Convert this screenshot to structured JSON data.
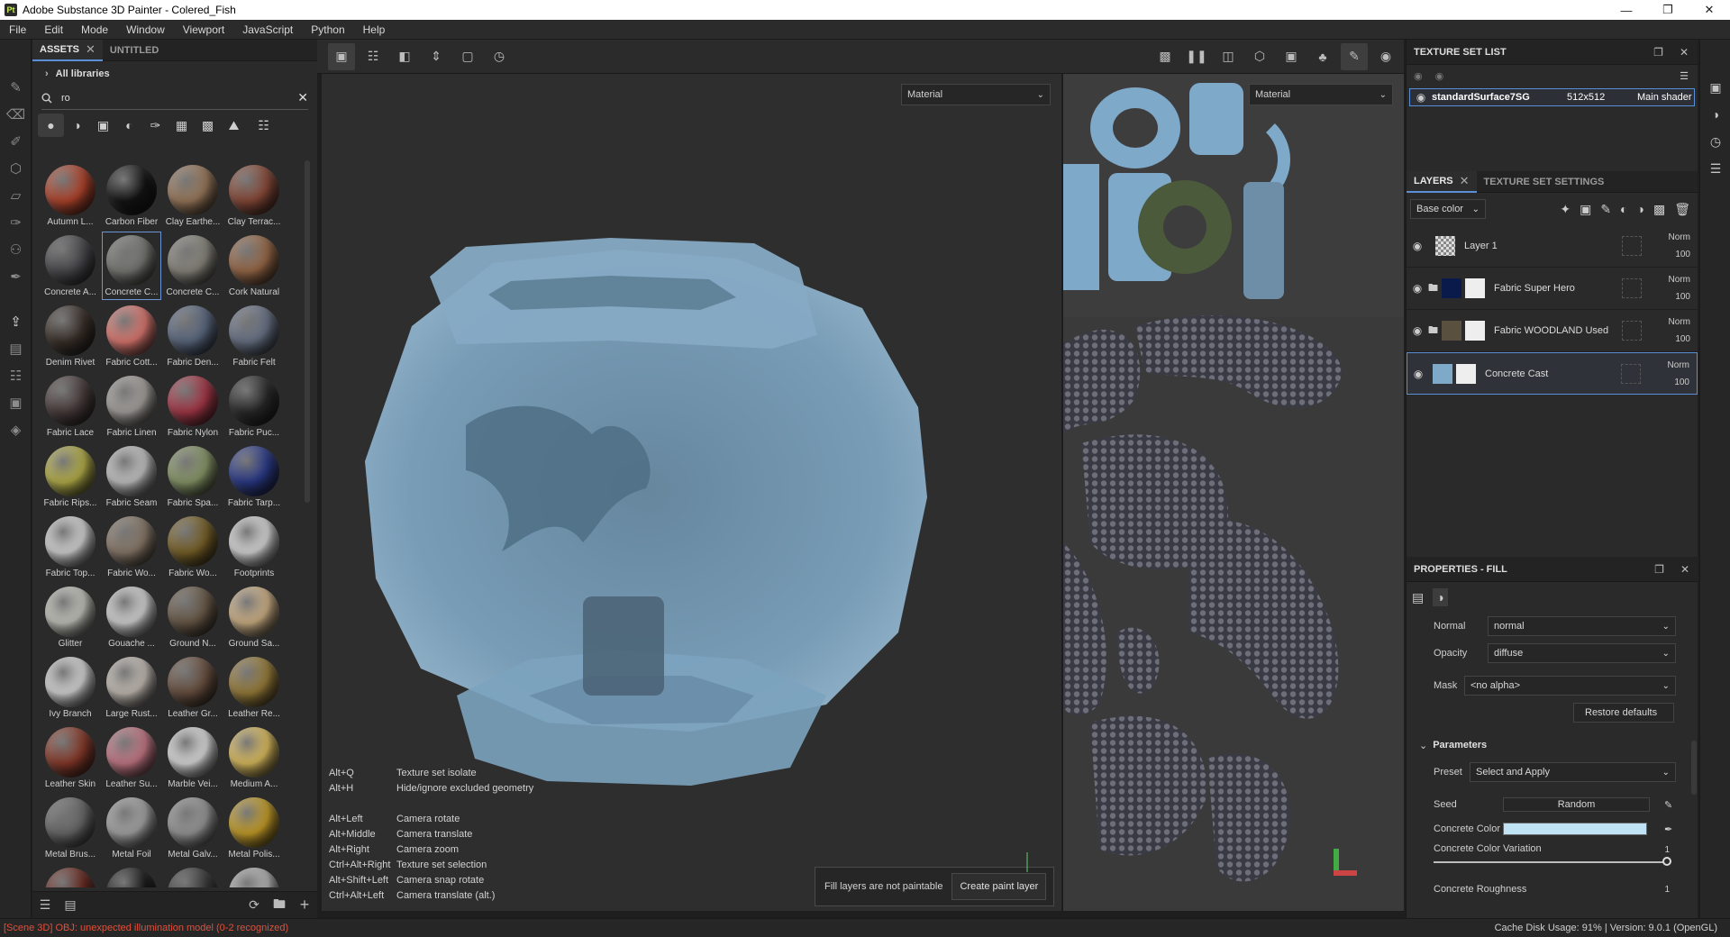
{
  "window": {
    "title": "Adobe Substance 3D Painter - Colered_Fish",
    "app_badge": "Pt"
  },
  "menu": [
    "File",
    "Edit",
    "Mode",
    "Window",
    "Viewport",
    "JavaScript",
    "Python",
    "Help"
  ],
  "assets": {
    "tabs": [
      {
        "label": "ASSETS"
      },
      {
        "label": "UNTITLED"
      }
    ],
    "library": "All libraries",
    "search_value": "ro",
    "items": [
      {
        "label": "Autumn L...",
        "color": "#b4452c"
      },
      {
        "label": "Carbon Fiber",
        "color": "#141414"
      },
      {
        "label": "Clay Earthe...",
        "color": "#9c7a5c"
      },
      {
        "label": "Clay Terrac...",
        "color": "#8a4a38"
      },
      {
        "label": "Concrete A...",
        "color": "#4a4a4e"
      },
      {
        "label": "Concrete C...",
        "color": "#7a7a76"
      },
      {
        "label": "Concrete C...",
        "color": "#8a887e"
      },
      {
        "label": "Cork Natural",
        "color": "#9a6a48"
      },
      {
        "label": "Denim Rivet",
        "color": "#3a302a"
      },
      {
        "label": "Fabric Cott...",
        "color": "#e07a72"
      },
      {
        "label": "Fabric Den...",
        "color": "#5c6a82"
      },
      {
        "label": "Fabric Felt",
        "color": "#6a7488"
      },
      {
        "label": "Fabric Lace",
        "color": "#4a3c3c"
      },
      {
        "label": "Fabric Linen",
        "color": "#a8a4a0"
      },
      {
        "label": "Fabric Nylon",
        "color": "#a83848"
      },
      {
        "label": "Fabric Puc...",
        "color": "#2a2a2a"
      },
      {
        "label": "Fabric Rips...",
        "color": "#b8b24a"
      },
      {
        "label": "Fabric Seam",
        "color": "#c8c8c8"
      },
      {
        "label": "Fabric Spa...",
        "color": "#8a9a6a"
      },
      {
        "label": "Fabric Tarp...",
        "color": "#2a3a8a"
      },
      {
        "label": "Fabric Top...",
        "color": "#d8d8d8"
      },
      {
        "label": "Fabric Wo...",
        "color": "#8a7a6a"
      },
      {
        "label": "Fabric Wo...",
        "color": "#7a6228"
      },
      {
        "label": "Footprints",
        "color": "#dcdcdc"
      },
      {
        "label": "Glitter",
        "color": "#c8c8c0"
      },
      {
        "label": "Gouache ...",
        "color": "#d8d8d8"
      },
      {
        "label": "Ground N...",
        "color": "#6a5a48"
      },
      {
        "label": "Ground Sa...",
        "color": "#d2b488"
      },
      {
        "label": "Ivy Branch",
        "color": "#dadada"
      },
      {
        "label": "Large Rust...",
        "color": "#c8c0b8"
      },
      {
        "label": "Leather Gr...",
        "color": "#6a5040"
      },
      {
        "label": "Leather Re...",
        "color": "#9a7e3a"
      },
      {
        "label": "Leather Skin",
        "color": "#8a3a2a"
      },
      {
        "label": "Leather Su...",
        "color": "#c87a88"
      },
      {
        "label": "Marble Vei...",
        "color": "#e0e0e0"
      },
      {
        "label": "Medium A...",
        "color": "#e0c060"
      },
      {
        "label": "Metal Brus...",
        "color": "#6a6a6a"
      },
      {
        "label": "Metal Foil",
        "color": "#a8a8a8"
      },
      {
        "label": "Metal Galv...",
        "color": "#9a9a9a"
      },
      {
        "label": "Metal Polis...",
        "color": "#c8a028"
      },
      {
        "label": "",
        "color": "#6a2a20"
      },
      {
        "label": "",
        "color": "#1a1a1a"
      },
      {
        "label": "",
        "color": "#3a3a3a"
      },
      {
        "label": "",
        "color": "#b8b8b8"
      }
    ]
  },
  "viewport3d": {
    "mode_dropdown": "Material",
    "shortcuts": [
      {
        "key": "Alt+Q",
        "action": "Texture set isolate"
      },
      {
        "key": "Alt+H",
        "action": "Hide/ignore excluded geometry"
      },
      {
        "key": "",
        "action": ""
      },
      {
        "key": "Alt+Left",
        "action": "Camera rotate"
      },
      {
        "key": "Alt+Middle",
        "action": "Camera translate"
      },
      {
        "key": "Alt+Right",
        "action": "Camera zoom"
      },
      {
        "key": "Ctrl+Alt+Right",
        "action": "Texture set selection"
      },
      {
        "key": "Alt+Shift+Left",
        "action": "Camera snap rotate"
      },
      {
        "key": "Ctrl+Alt+Left",
        "action": "Camera translate (alt.)"
      }
    ],
    "notice_text": "Fill layers are not paintable",
    "notice_button": "Create paint layer"
  },
  "viewport2d": {
    "mode_dropdown": "Material"
  },
  "texture_set_list": {
    "title": "TEXTURE SET LIST",
    "row": {
      "name": "standardSurface7SG",
      "size": "512x512",
      "shader": "Main shader"
    }
  },
  "layers": {
    "tabs": [
      {
        "label": "LAYERS"
      },
      {
        "label": "TEXTURE SET SETTINGS"
      }
    ],
    "channel": "Base color",
    "items": [
      {
        "name": "Layer 1",
        "blend": "Norm",
        "opacity": "100"
      },
      {
        "name": "Fabric Super Hero",
        "blend": "Norm",
        "opacity": "100"
      },
      {
        "name": "Fabric WOODLAND Used",
        "blend": "Norm",
        "opacity": "100"
      },
      {
        "name": "Concrete Cast",
        "blend": "Norm",
        "opacity": "100"
      }
    ]
  },
  "properties": {
    "title": "PROPERTIES - FILL",
    "normal_label": "Normal",
    "normal_value": "normal",
    "opacity_label": "Opacity",
    "opacity_value": "diffuse",
    "mask_label": "Mask",
    "mask_value": "<no alpha>",
    "restore_label": "Restore defaults",
    "params_label": "Parameters",
    "preset_label": "Preset",
    "preset_value": "Select and Apply",
    "seed_label": "Seed",
    "seed_value": "Random",
    "color_label": "Concrete Color",
    "color_value": "#bfe3f5",
    "variation_label": "Concrete Color Variation",
    "variation_value": "1",
    "roughness_label": "Concrete Roughness",
    "roughness_value": "1"
  },
  "status": {
    "error": "[Scene 3D] OBJ: unexpected illumination model (0-2 recognized)",
    "info": "Cache Disk Usage:   91% | Version: 9.0.1 (OpenGL)"
  }
}
